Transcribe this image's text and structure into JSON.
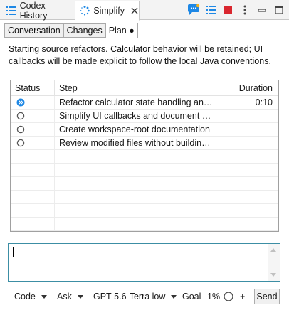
{
  "view_tabs": [
    {
      "label": "Codex History",
      "icon": "list-icon"
    },
    {
      "label": "Simplify",
      "icon": "spinner-icon",
      "close": "close-icon"
    }
  ],
  "toolbar": {
    "icons": [
      "chat-icon",
      "list-icon",
      "stop-icon",
      "more-icon",
      "minimize-icon",
      "maximize-icon"
    ],
    "accent_blue": "#1e88e5",
    "stop_red": "#d9262e"
  },
  "content_tabs": [
    {
      "label": "Conversation"
    },
    {
      "label": "Changes"
    },
    {
      "label": "Plan ●",
      "active": true
    }
  ],
  "intro_text": "Starting source refactors. Calculator behavior will be retained; UI callbacks will be made explicit to follow the local Java conventions.",
  "table": {
    "headers": [
      "Status",
      "Step",
      "Duration"
    ],
    "rows": [
      {
        "status": "in-progress",
        "step": "Refactor calculator state handling and c...",
        "duration": "0:10"
      },
      {
        "status": "pending",
        "step": "Simplify UI callbacks and document sup...",
        "duration": ""
      },
      {
        "status": "pending",
        "step": "Create workspace-root documentation",
        "duration": ""
      },
      {
        "status": "pending",
        "step": "Review modified files without building ...",
        "duration": ""
      }
    ],
    "empty_rows": 7
  },
  "input": {
    "value": ""
  },
  "bottom_bar": {
    "mode": "Code",
    "approval": "Ask",
    "model": "GPT-5.6-Terra low",
    "goal": "Goal",
    "progress": "1%",
    "plus": "+",
    "send": "Send"
  }
}
